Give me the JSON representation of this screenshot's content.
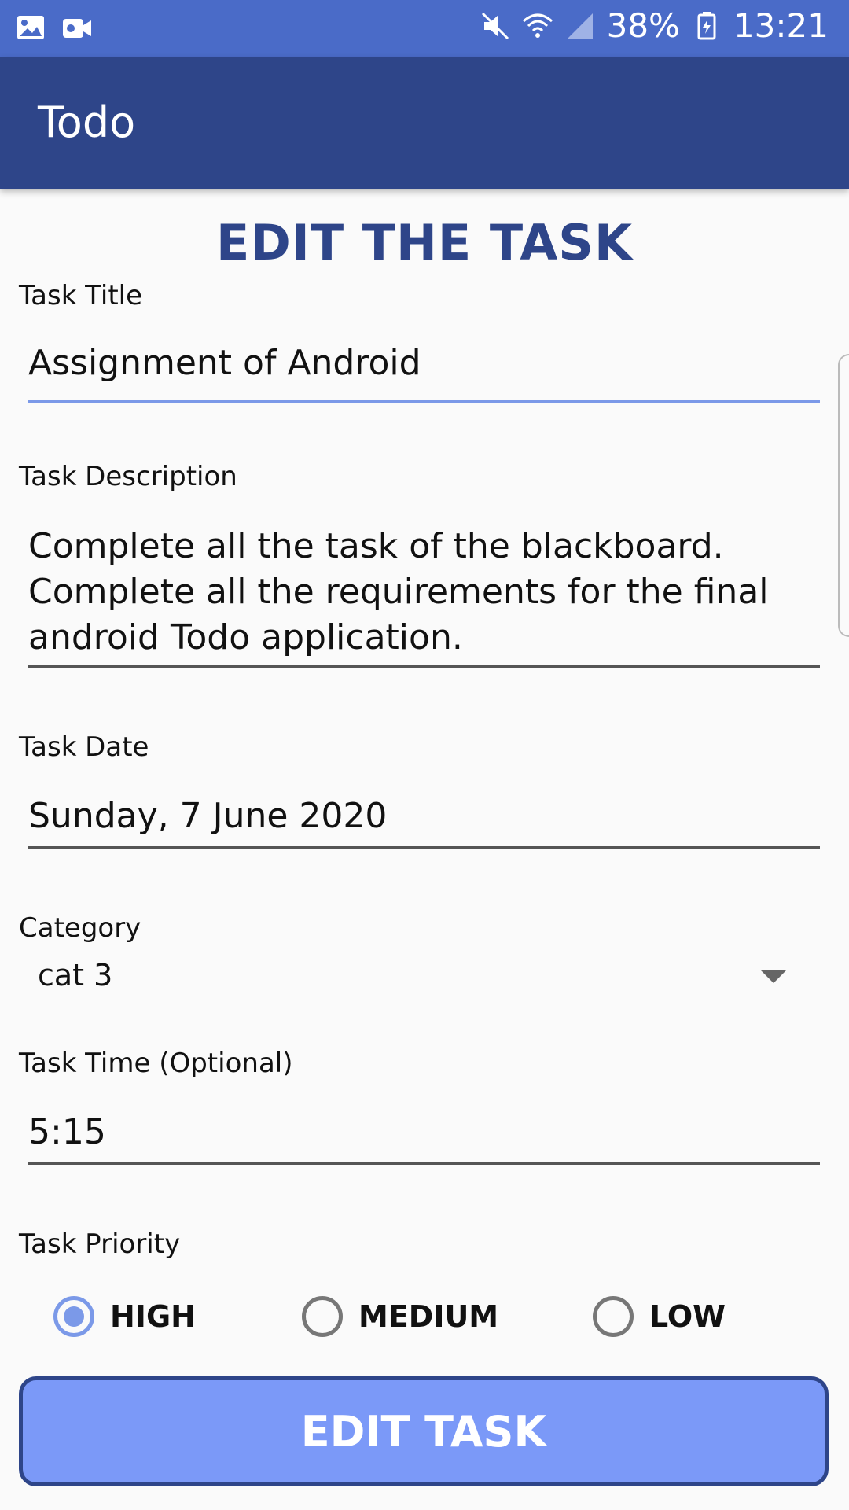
{
  "status_bar": {
    "battery": "38%",
    "time": "13:21"
  },
  "app_bar": {
    "title": "Todo"
  },
  "heading": "EDIT THE TASK",
  "form": {
    "title": {
      "label": "Task Title",
      "value": "Assignment of Android"
    },
    "description": {
      "label": "Task Description",
      "lines": [
        "Complete all the task of the blackboard.",
        "Complete all the requirements for the final",
        "android Todo application."
      ]
    },
    "date": {
      "label": "Task Date",
      "value": "Sunday, 7 June 2020"
    },
    "category": {
      "label": "Category",
      "value": "cat 3"
    },
    "time": {
      "label": "Task Time (Optional)",
      "value": "5:15"
    },
    "priority": {
      "label": "Task Priority",
      "options": [
        "HIGH",
        "MEDIUM",
        "LOW"
      ],
      "selected": "HIGH"
    }
  },
  "button": {
    "label": "EDIT TASK"
  },
  "colors": {
    "status_bar": "#4a6bc8",
    "app_bar": "#2e4589",
    "accent": "#7b99e8",
    "button": "#7b99f8"
  },
  "icons": [
    "image-icon",
    "video-icon",
    "mute-icon",
    "wifi-icon",
    "signal-icon",
    "battery-icon",
    "dropdown-arrow-icon"
  ]
}
